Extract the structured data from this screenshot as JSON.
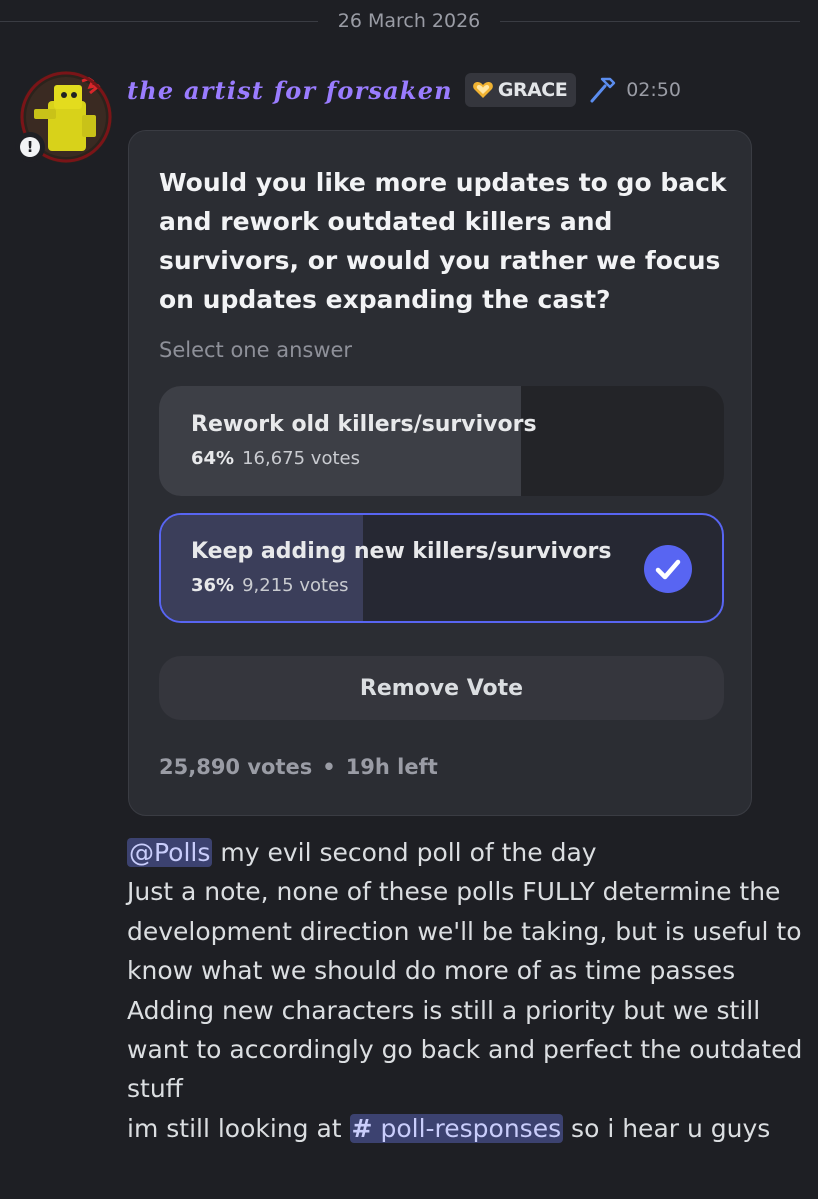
{
  "divider": {
    "date": "26 March 2026"
  },
  "message": {
    "author": "the artist for forsaken",
    "badge_icon": "heart-badge-icon",
    "role_tag": "GRACE",
    "role_icon": "hammer-icon",
    "timestamp": "02:50"
  },
  "poll": {
    "question": "Would you like more updates to go back and rework outdated killers and survivors, or would you rather we focus on updates expanding the cast?",
    "hint": "Select one answer",
    "answers": [
      {
        "label": "Rework old killers/survivors",
        "percent_text": "64%",
        "votes_text": "16,675 votes",
        "fill": 0.64,
        "selected": false
      },
      {
        "label": "Keep adding new killers/survivors",
        "percent_text": "36%",
        "votes_text": "9,215 votes",
        "fill": 0.36,
        "selected": true
      }
    ],
    "remove_vote_label": "Remove Vote",
    "total_votes": "25,890 votes",
    "separator": "•",
    "time_left": "19h left"
  },
  "body": {
    "mention": "@Polls",
    "line1_rest": " my evil second poll of the day",
    "para": "Just a note, none of these polls FULLY determine the development direction we'll be taking, but is useful to know what we should do more of as time passes Adding new characters is still a priority but we still want to accordingly go back and perfect the outdated stuff",
    "last_prefix": "im still looking at ",
    "channel_hash": "#",
    "channel_name": "poll-responses",
    "last_suffix": " so i hear u guys"
  },
  "colors": {
    "accent": "#5865f2",
    "username": "#9a7cff",
    "background": "#1e1f24"
  }
}
